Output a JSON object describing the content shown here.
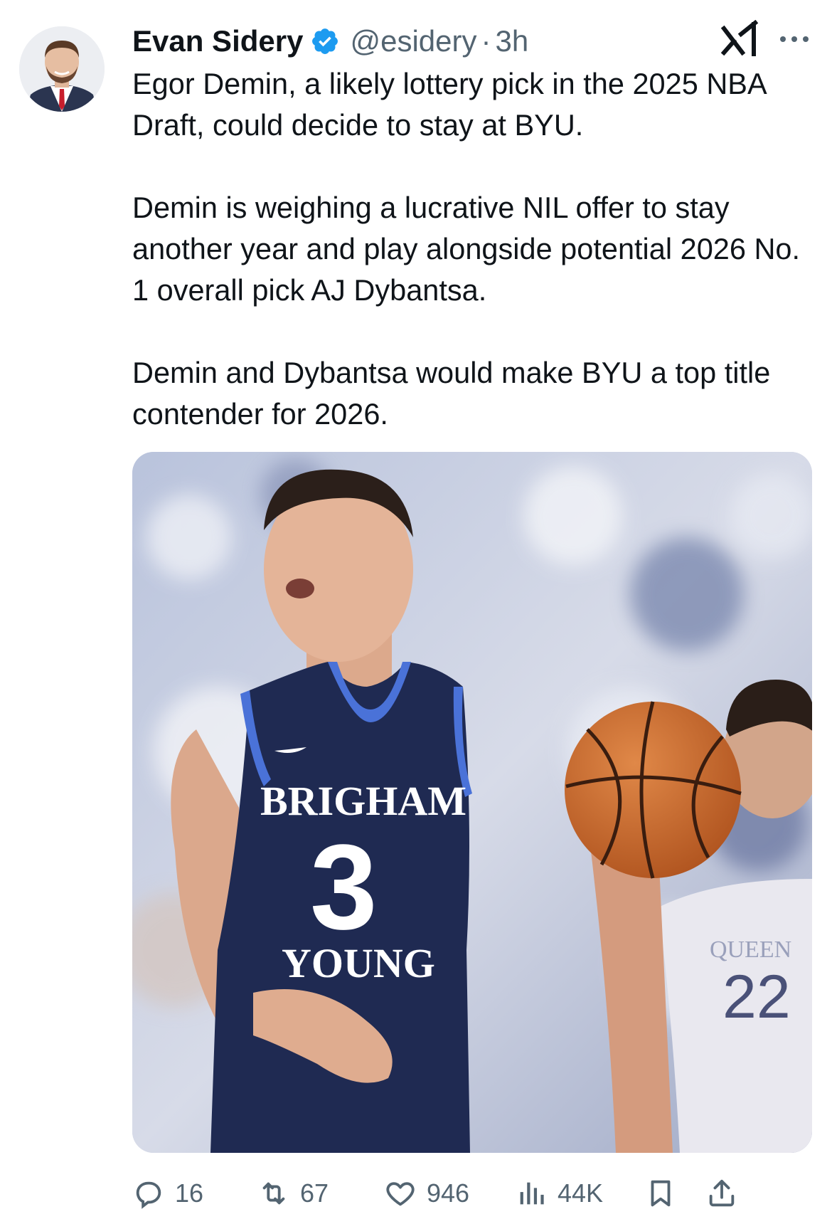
{
  "tweet": {
    "author": {
      "name": "Evan Sidery",
      "handle": "@esidery",
      "verified": true
    },
    "separator": "·",
    "time": "3h",
    "paragraphs": [
      "Egor Demin, a likely lottery pick in the 2025 NBA Draft, could decide to stay at BYU.",
      "Demin is weighing a lucrative NIL offer to stay another year and play alongside potential 2026 No. 1 overall pick AJ Dybantsa.",
      "Demin and Dybantsa would make BYU a top title contender for 2026."
    ],
    "media": {
      "jersey_wordmark_top": "BRIGHAM",
      "jersey_number": "3",
      "jersey_wordmark_bottom": "YOUNG",
      "opponent_number": "22",
      "opponent_wordmark": "QUEEN"
    }
  },
  "actions": {
    "replies": "16",
    "reposts": "67",
    "likes": "946",
    "views": "44K"
  },
  "icons": {
    "verified": "verified-badge-icon",
    "grok": "grok-icon",
    "more": "more-icon",
    "reply": "reply-icon",
    "repost": "repost-icon",
    "like": "heart-icon",
    "views": "views-icon",
    "bookmark": "bookmark-icon",
    "share": "share-icon"
  },
  "colors": {
    "verified": "#1d9bf0",
    "text": "#0f1419",
    "secondary": "#536471"
  }
}
